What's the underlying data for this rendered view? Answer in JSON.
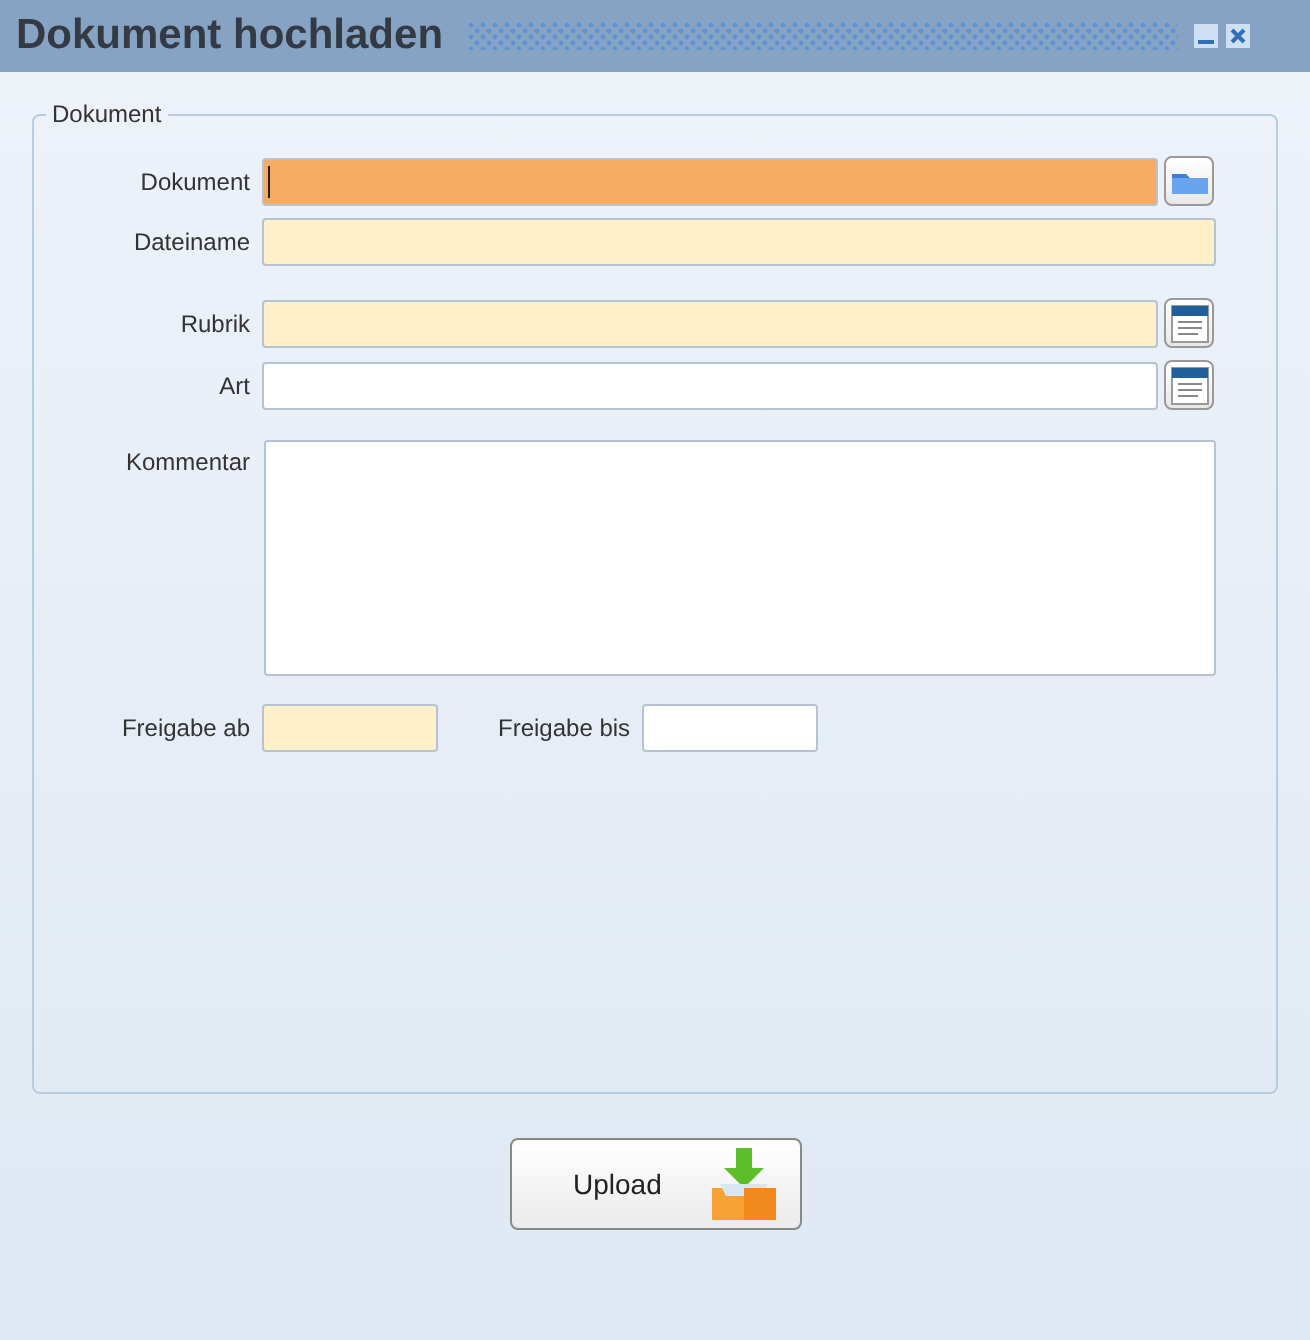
{
  "window": {
    "title": "Dokument hochladen"
  },
  "fieldset": {
    "legend": "Dokument"
  },
  "fields": [
    {
      "label": "Dokument",
      "kind": "picker",
      "required": true,
      "focused": true
    },
    {
      "label": "Dateiname",
      "kind": "text",
      "required": true,
      "focused": false
    },
    {
      "label": "Rubrik",
      "kind": "lookup",
      "required": true,
      "focused": false
    },
    {
      "label": "Art",
      "kind": "lookup",
      "required": false,
      "focused": false
    },
    {
      "label": "Kommentar",
      "kind": "textarea",
      "required": false,
      "focused": false
    }
  ],
  "dates": [
    {
      "label": "Freigabe ab",
      "required": true
    },
    {
      "label": "Freigabe bis",
      "required": false
    }
  ],
  "upload_button": {
    "label": "Upload"
  }
}
